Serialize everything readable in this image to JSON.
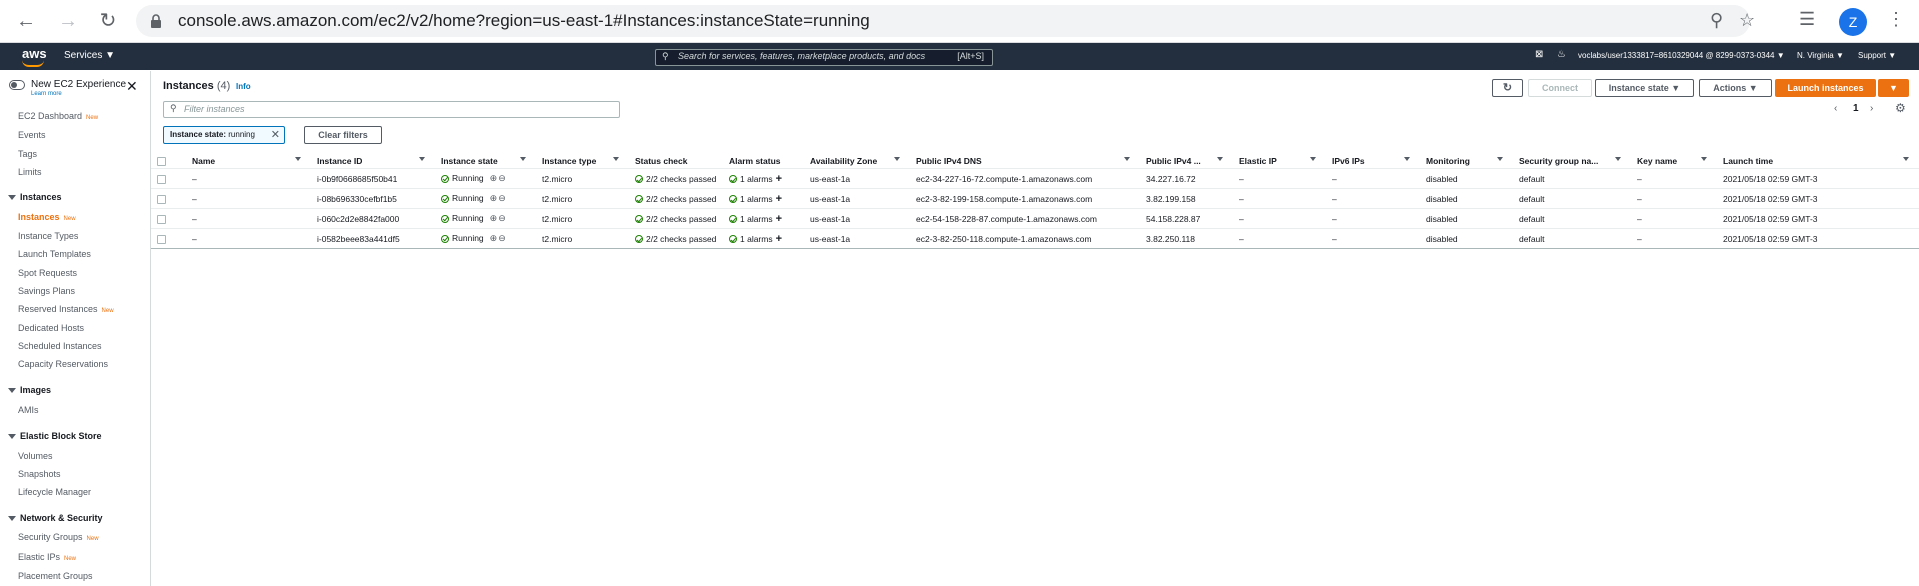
{
  "browser": {
    "url": "console.aws.amazon.com/ec2/v2/home?region=us-east-1#Instances:instanceState=running",
    "avatar_letter": "Z"
  },
  "header": {
    "logo": "aws",
    "services": "Services ▼",
    "search_placeholder": "Search for services, features, marketplace products, and docs",
    "search_shortcut": "[Alt+S]",
    "account": "voclabs/user1333817=8610329044 @ 8299-0373-0344 ▼",
    "region": "N. Virginia ▼",
    "support": "Support ▼"
  },
  "sidebar": {
    "new_experience": "New EC2 Experience",
    "learn_more": "Learn more",
    "top_items": [
      {
        "label": "EC2 Dashboard",
        "badge": "New"
      },
      {
        "label": "Events"
      },
      {
        "label": "Tags"
      },
      {
        "label": "Limits"
      }
    ],
    "sections": [
      {
        "title": "Instances",
        "items": [
          {
            "label": "Instances",
            "badge": "New",
            "active": true
          },
          {
            "label": "Instance Types"
          },
          {
            "label": "Launch Templates"
          },
          {
            "label": "Spot Requests"
          },
          {
            "label": "Savings Plans"
          },
          {
            "label": "Reserved Instances",
            "badge": "New"
          },
          {
            "label": "Dedicated Hosts"
          },
          {
            "label": "Scheduled Instances"
          },
          {
            "label": "Capacity Reservations"
          }
        ]
      },
      {
        "title": "Images",
        "items": [
          {
            "label": "AMIs"
          }
        ]
      },
      {
        "title": "Elastic Block Store",
        "items": [
          {
            "label": "Volumes"
          },
          {
            "label": "Snapshots"
          },
          {
            "label": "Lifecycle Manager"
          }
        ]
      },
      {
        "title": "Network & Security",
        "items": [
          {
            "label": "Security Groups",
            "badge": "New"
          },
          {
            "label": "Elastic IPs",
            "badge": "New"
          },
          {
            "label": "Placement Groups"
          }
        ]
      }
    ]
  },
  "main": {
    "title": "Instances",
    "count": "(4)",
    "info": "Info",
    "buttons": {
      "connect": "Connect",
      "instance_state": "Instance state ▼",
      "actions": "Actions ▼",
      "launch": "Launch instances",
      "launch_dropdown": "▼"
    },
    "filter_placeholder": "Filter instances",
    "chip_key": "Instance state:",
    "chip_value": " running",
    "clear_filters": "Clear filters",
    "page": "1",
    "columns": [
      "Name",
      "Instance ID",
      "Instance state",
      "Instance type",
      "Status check",
      "Alarm status",
      "Availability Zone",
      "Public IPv4 DNS",
      "Public IPv4 ...",
      "Elastic IP",
      "IPv6 IPs",
      "Monitoring",
      "Security group na...",
      "Key name",
      "Launch time"
    ],
    "rows": [
      {
        "name": "–",
        "id": "i-0b9f0668685f50b41",
        "state": "Running",
        "type": "t2.micro",
        "status": "2/2 checks passed",
        "alarm": "1 alarms",
        "az": "us-east-1a",
        "dns": "ec2-34-227-16-72.compute-1.amazonaws.com",
        "ipv4": "34.227.16.72",
        "eip": "–",
        "ipv6": "–",
        "monitoring": "disabled",
        "sg": "default",
        "key": "–",
        "launch": "2021/05/18 02:59 GMT-3"
      },
      {
        "name": "–",
        "id": "i-08b696330cefbf1b5",
        "state": "Running",
        "type": "t2.micro",
        "status": "2/2 checks passed",
        "alarm": "1 alarms",
        "az": "us-east-1a",
        "dns": "ec2-3-82-199-158.compute-1.amazonaws.com",
        "ipv4": "3.82.199.158",
        "eip": "–",
        "ipv6": "–",
        "monitoring": "disabled",
        "sg": "default",
        "key": "–",
        "launch": "2021/05/18 02:59 GMT-3"
      },
      {
        "name": "–",
        "id": "i-060c2d2e8842fa000",
        "state": "Running",
        "type": "t2.micro",
        "status": "2/2 checks passed",
        "alarm": "1 alarms",
        "az": "us-east-1a",
        "dns": "ec2-54-158-228-87.compute-1.amazonaws.com",
        "ipv4": "54.158.228.87",
        "eip": "–",
        "ipv6": "–",
        "monitoring": "disabled",
        "sg": "default",
        "key": "–",
        "launch": "2021/05/18 02:59 GMT-3"
      },
      {
        "name": "–",
        "id": "i-0582beee83a441df5",
        "state": "Running",
        "type": "t2.micro",
        "status": "2/2 checks passed",
        "alarm": "1 alarms",
        "az": "us-east-1a",
        "dns": "ec2-3-82-250-118.compute-1.amazonaws.com",
        "ipv4": "3.82.250.118",
        "eip": "–",
        "ipv6": "–",
        "monitoring": "disabled",
        "sg": "default",
        "key": "–",
        "launch": "2021/05/18 02:59 GMT-3"
      }
    ]
  },
  "colors": {
    "accent": "#ec7211",
    "link": "#0073bb",
    "header": "#232f3e",
    "success": "#1d8102"
  }
}
